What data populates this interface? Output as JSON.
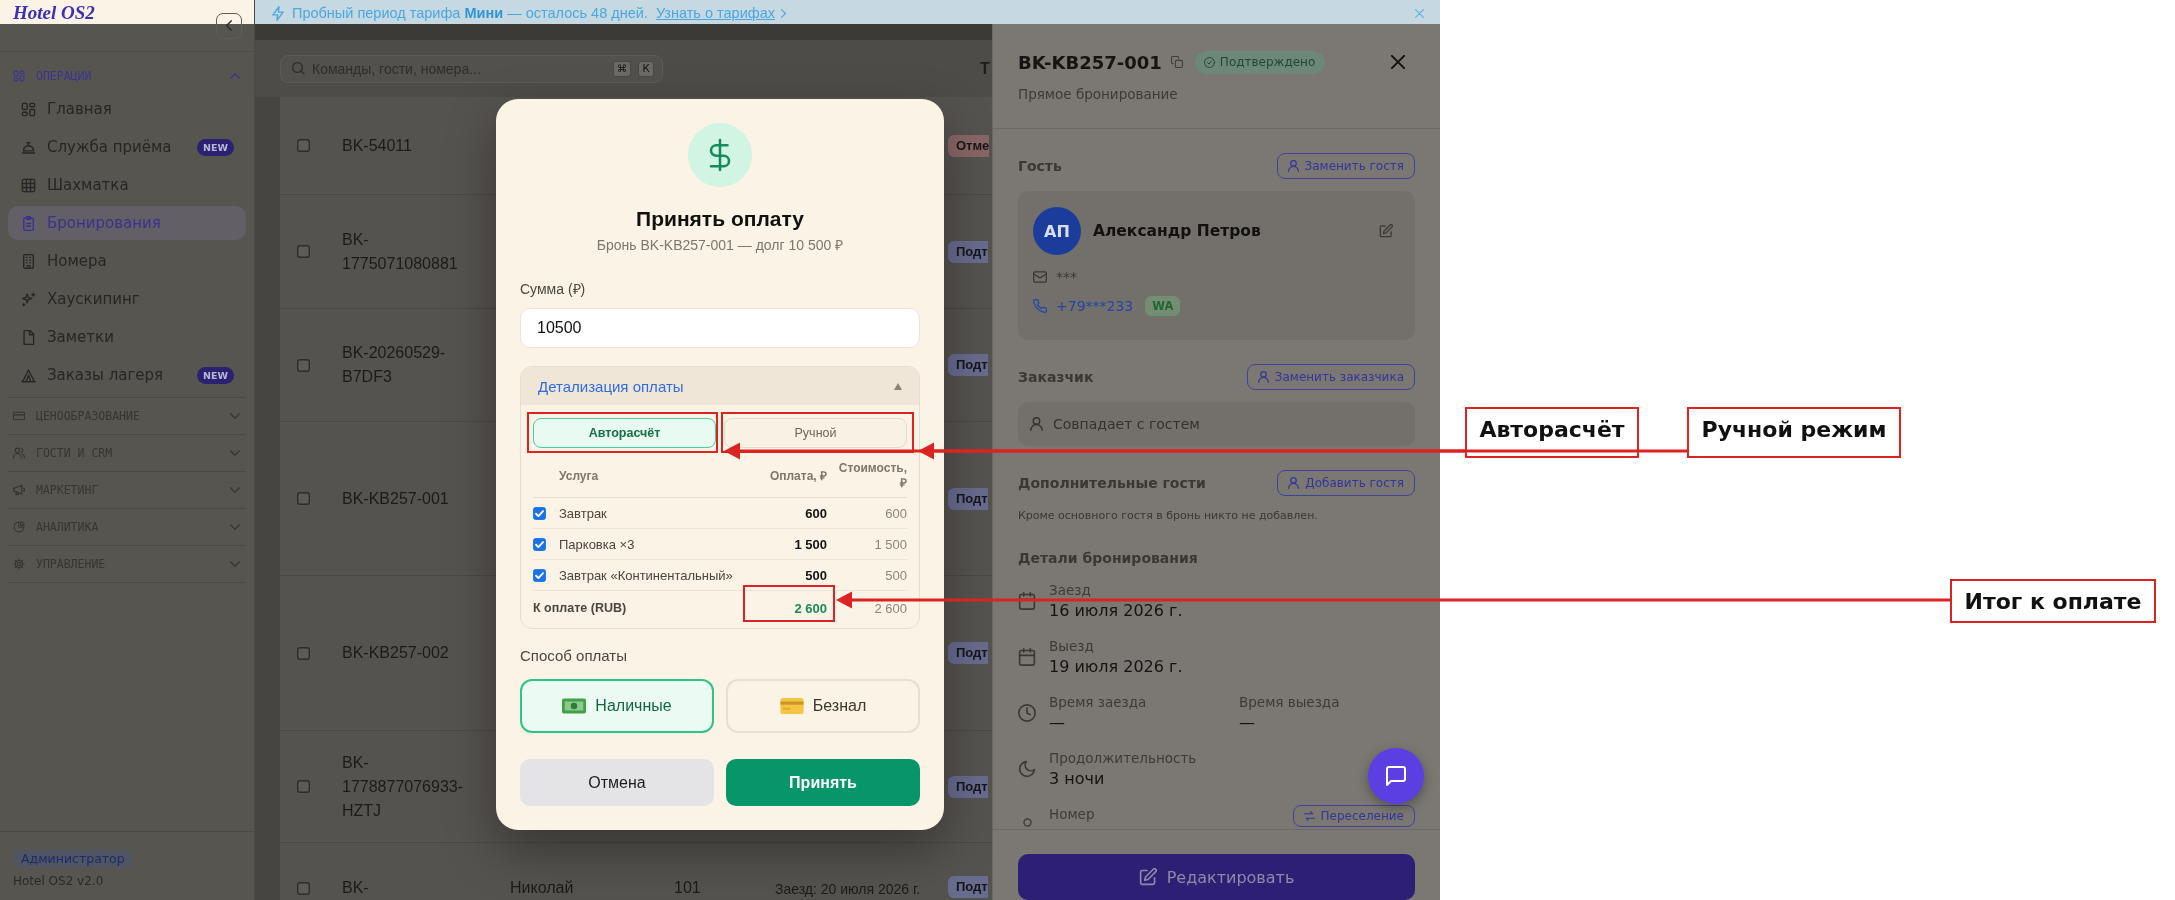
{
  "banner": {
    "message": "Пробный период тарифа **Мини** — осталось 48 дней.",
    "link": "Узнать о тарифах"
  },
  "sidebar": {
    "logo": "Hotel OS2",
    "sections": [
      {
        "title": "ОПЕРАЦИИ",
        "expanded": true,
        "items": [
          {
            "label": "Главная",
            "selected": false
          },
          {
            "label": "Служба приёма",
            "badge": "NEW",
            "selected": false
          },
          {
            "label": "Шахматка",
            "selected": false
          },
          {
            "label": "Бронирования",
            "selected": true
          },
          {
            "label": "Номера",
            "selected": false
          },
          {
            "label": "Хаускипинг",
            "selected": false
          },
          {
            "label": "Заметки",
            "selected": false
          },
          {
            "label": "Заказы лагеря",
            "badge": "NEW",
            "selected": false
          }
        ]
      },
      {
        "title": "ЦЕНООБРАЗОВАНИЕ",
        "expanded": false
      },
      {
        "title": "ГОСТИ И CRM",
        "expanded": false
      },
      {
        "title": "МАРКЕТИНГ",
        "expanded": false
      },
      {
        "title": "АНАЛИТИКА",
        "expanded": false
      },
      {
        "title": "УПРАВЛЕНИЕ",
        "expanded": false
      }
    ],
    "role": "Администратор",
    "version": "Hotel OS2 v2.0"
  },
  "search": {
    "placeholder": "Команды, гости, номера...",
    "shortcut": [
      "⌘",
      "К"
    ]
  },
  "toolbar_cut_text": "Т",
  "bookings": [
    {
      "id": "BK-54011",
      "checked": false,
      "status": {
        "text": "Отме",
        "color": "#8a6666"
      }
    },
    {
      "id": "BK-1775071080881",
      "checked": false,
      "status": {
        "text": "Подт",
        "color": "#686c8e"
      }
    },
    {
      "id": "BK-20260529-B7DF3",
      "checked": false,
      "status": {
        "text": "Подт",
        "color": "#686c8e"
      }
    },
    {
      "id": "BK-KB257-001",
      "checked": false,
      "status": {
        "text": "Подт",
        "color": "#686c8e"
      }
    },
    {
      "id": "BK-KB257-002",
      "checked": false,
      "status": {
        "text": "Подт",
        "color": "#686c8e"
      }
    },
    {
      "id": "BK-1778877076933-HZTJ",
      "checked": false,
      "status": {
        "text": "Подт",
        "color": "#686c8e"
      }
    },
    {
      "id": "BK-",
      "guest": "Николай",
      "room": "101",
      "dates": "Заезд: 20 июля 2026 г.",
      "checked": false,
      "status": {
        "text": "Подт",
        "color": "#686c8e"
      }
    }
  ],
  "payment_dialog": {
    "title": "Принять оплату",
    "subtitle": "Бронь BK-KB257-001 — долг 10 500 ₽",
    "amount_label": "Сумма (₽)",
    "amount": "10500",
    "breakdown": {
      "title": "Детализация оплаты",
      "expanded": true,
      "modes": [
        {
          "label": "Авторасчёт",
          "selected": true
        },
        {
          "label": "Ручной",
          "selected": false
        }
      ],
      "columns": [
        "Услуга",
        "Оплата, ₽",
        "Стоимость, ₽"
      ],
      "rows": [
        {
          "service": "Завтрак",
          "checked": true,
          "payment": "600",
          "cost": "600"
        },
        {
          "service": "Парковка ×3",
          "checked": true,
          "payment": "1 500",
          "cost": "1 500"
        },
        {
          "service": "Завтрак «Континентальный»",
          "checked": true,
          "payment": "500",
          "cost": "500"
        }
      ],
      "total": {
        "label": "К оплате (RUB)",
        "payment": "2 600",
        "cost": "2 600"
      }
    },
    "method_label": "Способ оплаты",
    "methods": [
      {
        "label": "Наличные",
        "selected": true
      },
      {
        "label": "Безнал",
        "selected": false
      }
    ],
    "actions": [
      {
        "label": "Отмена",
        "kind": "secondary"
      },
      {
        "label": "Принять",
        "kind": "primary"
      }
    ]
  },
  "booking_panel": {
    "code": "BK-KB257-001",
    "status": "Подтверждено",
    "source": "Прямое бронирование",
    "guest": {
      "title": "Гость",
      "action": "Заменить гостя",
      "initials": "АП",
      "name": "Александр Петров",
      "email": "***",
      "phone": "+79***233",
      "messenger": "WA"
    },
    "customer": {
      "title": "Заказчик",
      "action": "Заменить заказчика",
      "value": "Совпадает с гостем"
    },
    "extra_guests": {
      "title": "Дополнительные гости",
      "action": "Добавить гостя",
      "note": "Кроме основного гостя в бронь никто не добавлен."
    },
    "details": {
      "title": "Детали бронирования",
      "items": [
        {
          "kind": "field",
          "label": "Заезд",
          "value": "16 июля 2026 г."
        },
        {
          "kind": "field",
          "label": "Выезд",
          "value": "19 июля 2026 г."
        },
        {
          "kind": "pair",
          "fields": [
            {
              "label": "Время заезда",
              "value": "—"
            },
            {
              "label": "Время выезда",
              "value": "—"
            }
          ]
        },
        {
          "kind": "field",
          "label": "Продолжительность",
          "value": "3 ночи"
        },
        {
          "kind": "action",
          "label": "Номер",
          "action": "Переселение"
        }
      ]
    },
    "edit_button": "Редактировать"
  },
  "callouts": [
    "Авторасчёт",
    "Ручной режим",
    "Итог к оплате"
  ]
}
